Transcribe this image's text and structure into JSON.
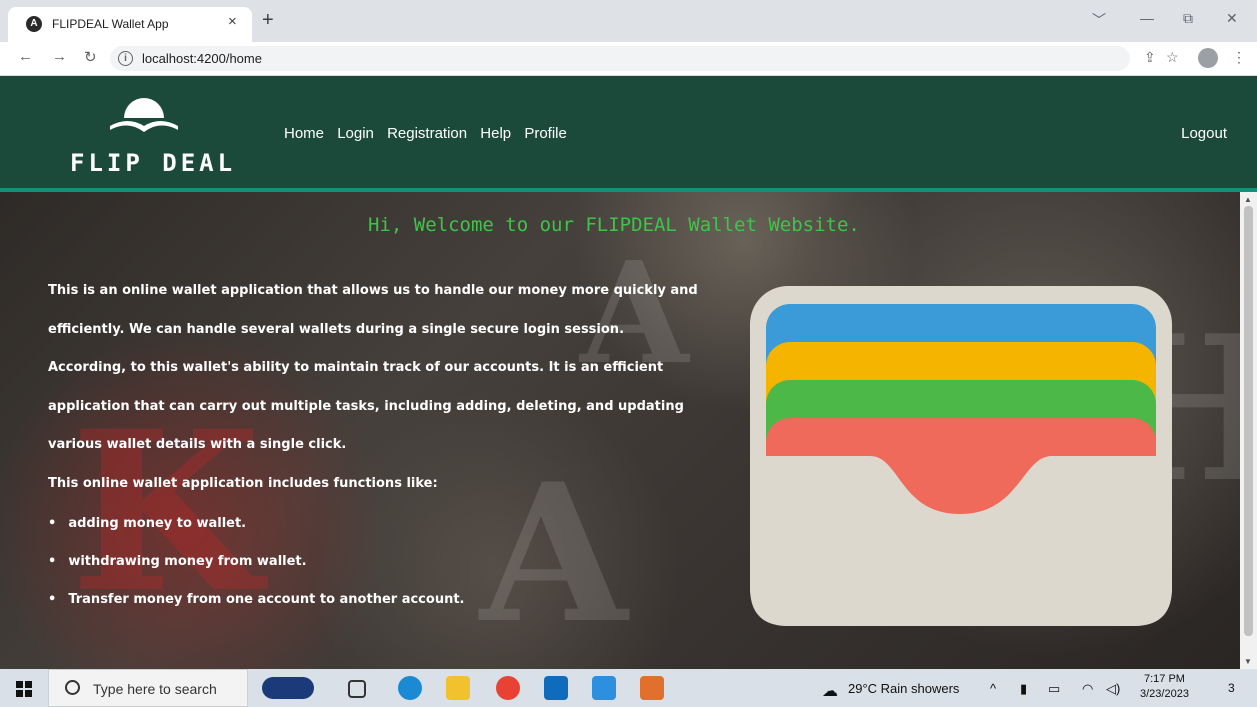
{
  "browser": {
    "tab_title": "FLIPDEAL Wallet App",
    "tab_close": "×",
    "new_tab": "+",
    "url": "localhost:4200/home",
    "window_controls": [
      "﹀",
      "—",
      "⧉",
      "✕"
    ]
  },
  "header": {
    "logo_text": "FLIP DEAL",
    "nav": [
      "Home",
      "Login",
      "Registration",
      "Help",
      "Profile"
    ],
    "logout": "Logout"
  },
  "main": {
    "welcome": "Hi, Welcome to our FLIPDEAL Wallet Website.",
    "description_lines": [
      "This is an online wallet application that allows us to handle our money more quickly and",
      "efficiently. We can handle several wallets during a single secure login session.",
      "According, to this wallet's ability to maintain track of our accounts. It is an efficient",
      "application that can carry out multiple tasks, including adding, deleting, and updating",
      "various wallet details with a single click.",
      "This online wallet application includes functions like:"
    ],
    "features": [
      "adding money to wallet.",
      "withdrawing money from wallet.",
      "Transfer money from one account to another account."
    ]
  },
  "taskbar": {
    "search_placeholder": "Type here to search",
    "weather": "29°C  Rain showers",
    "time": "7:17 PM",
    "date": "3/23/2023",
    "notification_count": "3"
  },
  "colors": {
    "header_bg": "#1b4a3a",
    "accent_line": "#159079",
    "welcome_text": "#3fc44a",
    "card_blue": "#3a9bd8",
    "card_yellow": "#f5b400",
    "card_green": "#4cb847",
    "card_red": "#ef6a5a",
    "wallet_body": "#dcd8cd"
  }
}
